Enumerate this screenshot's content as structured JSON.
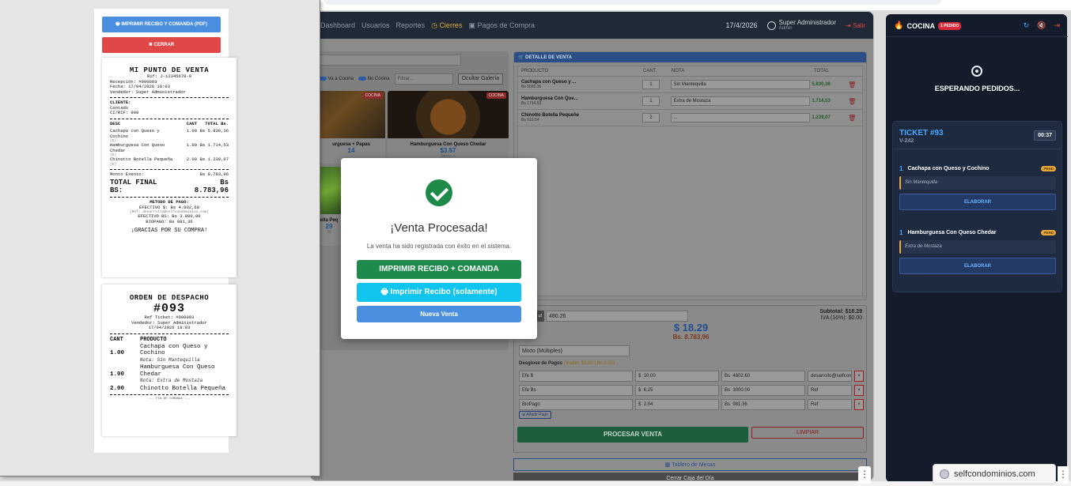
{
  "app": {
    "nav": [
      "Dashboard",
      "Usuarios",
      "Reportes",
      "Cierres",
      "Pagos de Compra"
    ],
    "active_nav": "Cierres",
    "date": "17/4/2026",
    "user_name": "Super Administrador",
    "user_role": "Admin",
    "logout": "Salir"
  },
  "products": {
    "toolbar": {
      "toggle_cocina": "Va a Cocina",
      "toggle_no_cocina": "No Cocina",
      "filter_placeholder": "Filtrar...",
      "hide_gallery": "Ocultar Galería"
    },
    "items": [
      {
        "name": "urguesa + Papas",
        "price": "14",
        "tag": "COCINA"
      },
      {
        "name": "Hamburguesa Con Queso Chedar",
        "price": "$3.57",
        "sub": "Stock: ∞",
        "tag": "COCINA"
      },
      {
        "name": "ella Peq",
        "price": "29",
        "sub": "00"
      }
    ]
  },
  "detail": {
    "header": "DETALLE DE VENTA",
    "columns": [
      "PRODUCTO",
      "CANT.",
      "NOTA",
      "TOTAL"
    ],
    "rows": [
      {
        "name": "Cachapa con Queso y ...",
        "price": "Bs 5830.36",
        "qty": "1",
        "note": "Sin Mantequilla",
        "total": "5.830,36"
      },
      {
        "name": "Hamburguesa Con Que...",
        "price": "Bs 1714.53",
        "qty": "1",
        "note": "Extra de Mostaza",
        "total": "1.714,53"
      },
      {
        "name": "Chinotto Botella Pequeñe",
        "price": "Bs 619.54",
        "qty": "2",
        "note": "...",
        "total": "1.239,07"
      }
    ]
  },
  "totals": {
    "rate": "480.26",
    "subtotal": "Subtotal: $18.29",
    "iva": "IVA (16%): $0.00",
    "usd": "$ 18.29",
    "bs": "Bs. 8.783,96",
    "pay_mode": "Mixto (Múltiples)",
    "desglose_label": "Desglose de Pagos",
    "desglose_status": "(Vuelto: $0.00 | Bs 0.00)",
    "rows": [
      {
        "method": "Efe $",
        "usd": "10.00",
        "bs": "4802.60",
        "ref": "desarrollo@selfcon"
      },
      {
        "method": "Efe Bs",
        "usd": "6.25",
        "bs": "3000.00",
        "ref": "Ref"
      },
      {
        "method": "BioPago",
        "usd": "2.04",
        "bs": "981.36",
        "ref": "Ref"
      }
    ],
    "usd_prefix": "$",
    "bs_prefix": "Bs",
    "remove_symbol": "×",
    "add_payment": "Añadir Pago",
    "process": "PROCESAR VENTA",
    "clear": "LIMPIAR",
    "tables": "Tablero de Mesas",
    "close_cash": "Cerrar Caja del Día"
  },
  "modal": {
    "title": "¡Venta Procesada!",
    "message": "La venta ha sido registrada con éxito en el sistema.",
    "btn_print_both": "IMPRIMIR RECIBO + COMANDA",
    "btn_print_receipt": "Imprimir Recibo (solamente)",
    "btn_new_sale": "Nueva Venta"
  },
  "print": {
    "btn_print": "IMPRIMIR RECIBO Y COMANDA (PDF)",
    "btn_close": "CERRAR",
    "receipt": {
      "store": "MI PUNTO DE VENTA",
      "rif": "Rif: J-12345678-9",
      "recepcion": "Recepción: #000093",
      "fecha": "Fecha: 17/04/2026 18:03",
      "vendedor": "Vendedor: Super Administrador",
      "cliente_label": "CLIENTE:",
      "cliente": "Contado",
      "ci": "CI/RIF: 999",
      "col_desc": "DESC",
      "col_cant": "CANT",
      "col_total": "TOTAL Bs.",
      "items": [
        {
          "desc": "Cachapa con Queso y Cochino",
          "qty": "1.00",
          "total": "Bs 5.830,36",
          "tag": "(E)"
        },
        {
          "desc": "Hamburguesa Con Queso Chedar",
          "qty": "1.00",
          "total": "Bs 1.714,53",
          "tag": "(E)"
        },
        {
          "desc": "Chinotto Botella Pequeña",
          "qty": "2.00",
          "total": "Bs 1.239,07",
          "tag": "(E)"
        }
      ],
      "exento_label": "Monto Exento:",
      "exento": "Bs 8.783,96",
      "total_label": "TOTAL FINAL",
      "total_currency": "Bs",
      "total_prefix": "BS:",
      "total_value": "8.783,96",
      "metodo": "METODO DE PAGO:",
      "pay1": "EFECTIVO $: Bs 4.802,60",
      "pay1_ref": "(Ref: desarrollo@selfcondominios.com)",
      "pay2": "EFECTIVO BS: Bs 3.000,00",
      "pay3": "BIOPAGO: Bs 981,36",
      "thanks": "¡GRACIAS POR SU COMPRA!"
    },
    "dispatch": {
      "title": "ORDEN DE DESPACHO",
      "number": "#093",
      "ref": "Ref Ticket: #000093",
      "vendedor": "Vendedor: Super Administrador",
      "fecha": "17/04/2026 18:03",
      "col_cant": "CANT",
      "col_prod": "PRODUCTO",
      "items": [
        {
          "qty": "1.00",
          "name": "Cachapa con Queso y Cochino",
          "note": "Nota: Sin Mantequilla"
        },
        {
          "qty": "1.00",
          "name": "Hamburguesa Con Queso Chedar",
          "note": "Nota: Extra de Mostaza"
        },
        {
          "qty": "2.00",
          "name": "Chinotto Botella Pequeña",
          "note": ""
        }
      ],
      "end": "--- FIN DE COMANDA ---"
    }
  },
  "kitchen": {
    "title": "COCINA",
    "badge": "1 PEDIDO",
    "waiting": "ESPERANDO PEDIDOS...",
    "ticket_title": "TICKET #93",
    "ticket_sub": "V-242",
    "timer": "00:37",
    "items": [
      {
        "qty": "1",
        "name": "Cachapa con Queso y Cochino",
        "status": "PEND",
        "note": "Sin Mantequilla",
        "action": "ELABORAR"
      },
      {
        "qty": "1",
        "name": "Hamburguesa Con Queso Chedar",
        "status": "PEND",
        "note": "Extra de Mostaza",
        "action": "ELABORAR"
      }
    ]
  },
  "browser": {
    "url_bubble": "selfcondominios.com",
    "more": "⋮"
  },
  "colors": {
    "success": "#1e8a4c",
    "info": "#10c4ee",
    "primary": "#4a8ee0",
    "danger": "#e04848",
    "kitchen_bg": "#141c2c",
    "accent_blue": "#4aa8ff",
    "pending": "#e8a93a"
  }
}
